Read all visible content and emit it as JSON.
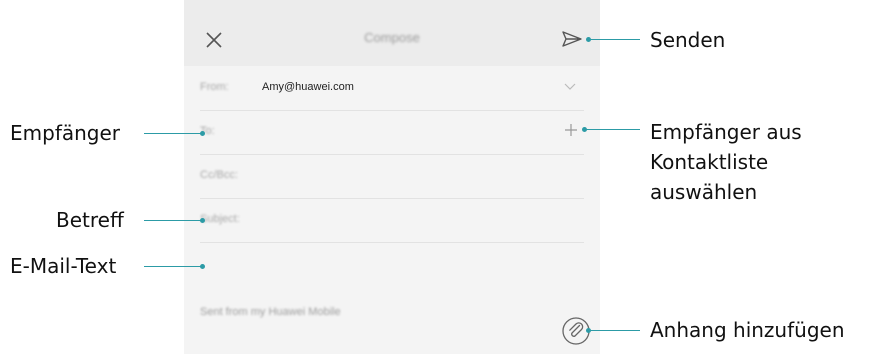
{
  "compose": {
    "title": "Compose",
    "from_label": "From:",
    "from_value": "Amy@huawei.com",
    "to_label": "To:",
    "ccbcc_label": "Cc/Bcc:",
    "subject_label": "Subject:",
    "signature": "Sent from my Huawei Mobile"
  },
  "callouts": {
    "send": "Senden",
    "recipient": "Empfänger",
    "contacts_line1": "Empfänger aus",
    "contacts_line2": "Kontaktliste",
    "contacts_line3": "auswählen",
    "subject": "Betreff",
    "body": "E-Mail-Text",
    "attachment": "Anhang hinzufügen"
  },
  "colors": {
    "accent": "#2c9ba6"
  },
  "icons": [
    "close-icon",
    "send-icon",
    "chevron-down-icon",
    "plus-icon",
    "attachment-icon"
  ]
}
